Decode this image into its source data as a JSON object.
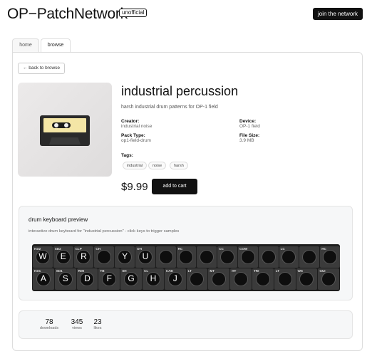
{
  "header": {
    "logo": "OP−PatchNetwork",
    "badge": "unofficial",
    "join_label": "join the network"
  },
  "tabs": [
    {
      "label": "home",
      "active": false
    },
    {
      "label": "browse",
      "active": true
    }
  ],
  "back_label": "← back to browse",
  "product": {
    "title": "industrial percussion",
    "description": "harsh industrial drum patterns for OP-1 field",
    "creator_label": "Creator:",
    "creator": "industrial noise",
    "device_label": "Device:",
    "device": "OP-1 field",
    "pack_type_label": "Pack Type:",
    "pack_type": "op1-field-drum",
    "file_size_label": "File Size:",
    "file_size": "3.9 MB",
    "tags_label": "Tags:",
    "tags": [
      "industrial",
      "noise",
      "harsh"
    ],
    "price": "$9.99",
    "cart_label": "add to cart"
  },
  "preview": {
    "title": "drum keyboard preview",
    "description": "interactive drum keyboard for \"industrial percussion\" - click keys to trigger samples",
    "top_row": [
      {
        "label": "KD2",
        "char": "W"
      },
      {
        "label": "SD2",
        "char": "E"
      },
      {
        "label": "CLP",
        "char": "R"
      },
      {
        "label": "CH",
        "char": ""
      },
      {
        "label": "",
        "char": "Y"
      },
      {
        "label": "OH",
        "char": "U"
      },
      {
        "label": "",
        "char": ""
      },
      {
        "label": "RC",
        "char": ""
      },
      {
        "label": "",
        "char": ""
      },
      {
        "label": "CC",
        "char": ""
      },
      {
        "label": "COW",
        "char": ""
      },
      {
        "label": "",
        "char": ""
      },
      {
        "label": "LC",
        "char": ""
      },
      {
        "label": "",
        "char": ""
      },
      {
        "label": "HC",
        "char": ""
      }
    ],
    "bottom_row": [
      {
        "label": "KD1",
        "char": "A"
      },
      {
        "label": "SD1",
        "char": "S"
      },
      {
        "label": "RIM",
        "char": "D"
      },
      {
        "label": "TB",
        "char": "F"
      },
      {
        "label": "SH",
        "char": "G"
      },
      {
        "label": "CL",
        "char": "H"
      },
      {
        "label": "CAB",
        "char": "J"
      },
      {
        "label": "LT",
        "char": ""
      },
      {
        "label": "MT",
        "char": ""
      },
      {
        "label": "HT",
        "char": ""
      },
      {
        "label": "TRI",
        "char": ""
      },
      {
        "label": "LT",
        "char": ""
      },
      {
        "label": "WS",
        "char": ""
      },
      {
        "label": "GUI",
        "char": ""
      }
    ]
  },
  "stats": [
    {
      "value": "78",
      "label": "downloads"
    },
    {
      "value": "345",
      "label": "views"
    },
    {
      "value": "23",
      "label": "likes"
    }
  ]
}
